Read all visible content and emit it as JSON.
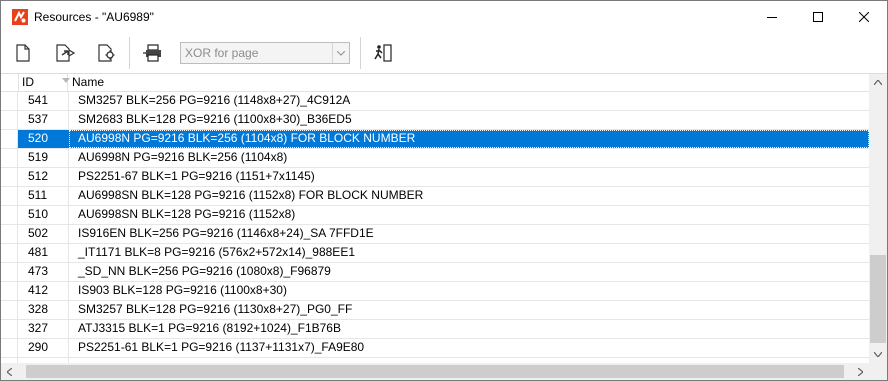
{
  "window": {
    "title": "Resources - \"AU6989\"",
    "icon": "app-logo-icon"
  },
  "toolbar": {
    "buttons": [
      {
        "name": "new-page-icon"
      },
      {
        "name": "open-arrow-icon"
      },
      {
        "name": "export-gear-icon"
      },
      {
        "name": "print-icon"
      },
      {
        "name": "exit-door-icon"
      }
    ],
    "combo": {
      "value": "XOR for page"
    }
  },
  "table": {
    "columns": {
      "id": "ID",
      "name": "Name"
    },
    "selected_color": "#0078d7",
    "rows": [
      {
        "id": "541",
        "name": "SM3257 BLK=256 PG=9216 (1148x8+27)_4C912A"
      },
      {
        "id": "537",
        "name": "SM2683 BLK=128 PG=9216 (1100x8+30)_B36ED5"
      },
      {
        "id": "520",
        "name": "AU6998N PG=9216 BLK=256 (1104x8) FOR BLOCK NUMBER",
        "selected": true
      },
      {
        "id": "519",
        "name": "AU6998N PG=9216 BLK=256 (1104x8)"
      },
      {
        "id": "512",
        "name": "PS2251-67 BLK=1 PG=9216 (1151+7x1145)"
      },
      {
        "id": "511",
        "name": "AU6998SN BLK=128 PG=9216 (1152x8) FOR BLOCK NUMBER"
      },
      {
        "id": "510",
        "name": "AU6998SN BLK=128 PG=9216 (1152x8)"
      },
      {
        "id": "502",
        "name": "IS916EN BLK=256 PG=9216 (1146x8+24)_SA 7FFD1E"
      },
      {
        "id": "481",
        "name": "_IT1171 BLK=8 PG=9216 (576x2+572x14)_988EE1"
      },
      {
        "id": "473",
        "name": "_SD_NN BLK=256 PG=9216 (1080x8)_F96879"
      },
      {
        "id": "412",
        "name": "IS903 BLK=128 PG=9216 (1100x8+30)"
      },
      {
        "id": "328",
        "name": "SM3257 BLK=128 PG=9216 (1130x8+27)_PG0_FF"
      },
      {
        "id": "327",
        "name": "ATJ3315 BLK=1 PG=9216 (8192+1024)_F1B76B"
      },
      {
        "id": "290",
        "name": "PS2251-61 BLK=1 PG=9216 (1137+1131x7)_FA9E80"
      },
      {
        "id": "",
        "name": ""
      }
    ]
  }
}
